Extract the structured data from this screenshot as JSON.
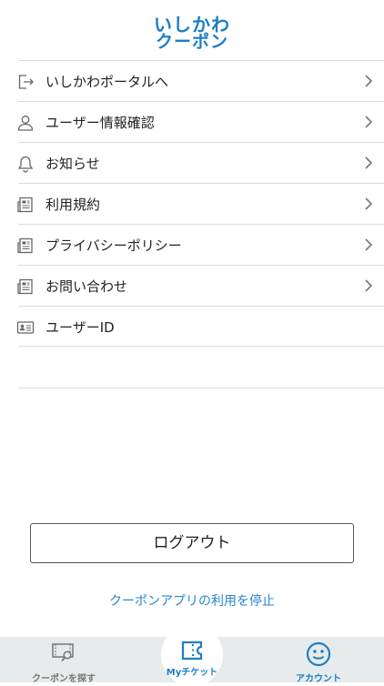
{
  "header": {
    "logo_line1": "いしかわ",
    "logo_line2": "クーポン"
  },
  "menu": {
    "items": [
      {
        "label": "いしかわポータルへ",
        "icon": "exit-icon"
      },
      {
        "label": "ユーザー情報確認",
        "icon": "user-icon"
      },
      {
        "label": "お知らせ",
        "icon": "bell-icon"
      },
      {
        "label": "利用規約",
        "icon": "document-icon"
      },
      {
        "label": "プライバシーポリシー",
        "icon": "document-icon"
      },
      {
        "label": "お問い合わせ",
        "icon": "document-icon"
      },
      {
        "label": "ユーザーID",
        "icon": "id-card-icon"
      }
    ]
  },
  "actions": {
    "logout_label": "ログアウト",
    "stop_label": "クーポンアプリの利用を停止"
  },
  "tabbar": {
    "tabs": [
      {
        "label": "クーポンを探す",
        "icon": "coupon-search-icon"
      },
      {
        "label": "Myチケット",
        "icon": "ticket-icon"
      },
      {
        "label": "アカウント",
        "icon": "smiley-icon"
      }
    ]
  },
  "colors": {
    "brand": "#1c7fc4",
    "link": "#2a86d1",
    "divider": "#dcdcdc",
    "tabbar_bg": "#e7ebec"
  }
}
